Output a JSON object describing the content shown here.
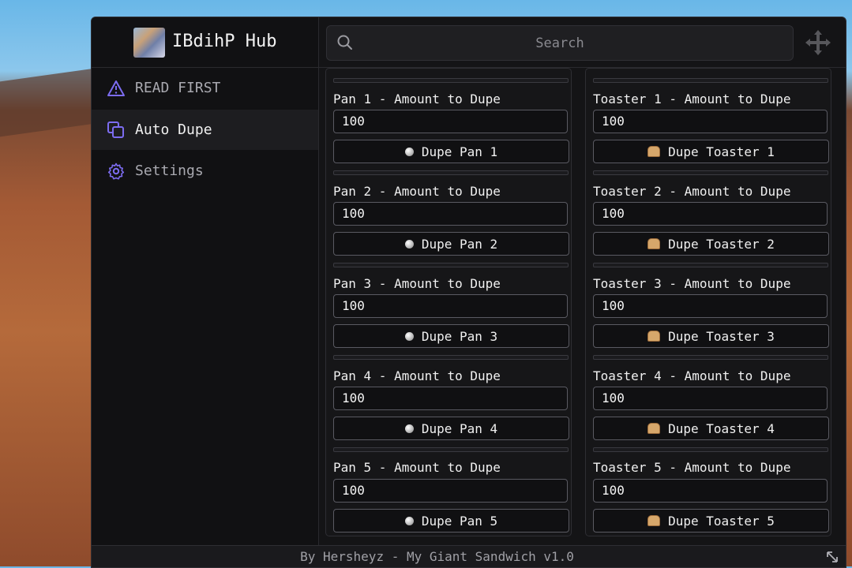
{
  "app": {
    "title": "IBdihP Hub"
  },
  "sidebar": {
    "items": [
      {
        "label": "READ FIRST",
        "icon": "warning-icon",
        "active": false
      },
      {
        "label": "Auto Dupe",
        "icon": "copy-icon",
        "active": true
      },
      {
        "label": "Settings",
        "icon": "gear-icon",
        "active": false
      }
    ]
  },
  "search": {
    "placeholder": "Search"
  },
  "pans": [
    {
      "label": "Pan 1 - Amount to Dupe",
      "value": "100",
      "button": "Dupe Pan 1"
    },
    {
      "label": "Pan 2 - Amount to Dupe",
      "value": "100",
      "button": "Dupe Pan 2"
    },
    {
      "label": "Pan 3 - Amount to Dupe",
      "value": "100",
      "button": "Dupe Pan 3"
    },
    {
      "label": "Pan 4 - Amount to Dupe",
      "value": "100",
      "button": "Dupe Pan 4"
    },
    {
      "label": "Pan 5 - Amount to Dupe",
      "value": "100",
      "button": "Dupe Pan 5"
    }
  ],
  "toasters": [
    {
      "label": "Toaster 1 - Amount to Dupe",
      "value": "100",
      "button": "Dupe Toaster 1"
    },
    {
      "label": "Toaster 2 - Amount to Dupe",
      "value": "100",
      "button": "Dupe Toaster 2"
    },
    {
      "label": "Toaster 3 - Amount to Dupe",
      "value": "100",
      "button": "Dupe Toaster 3"
    },
    {
      "label": "Toaster 4 - Amount to Dupe",
      "value": "100",
      "button": "Dupe Toaster 4"
    },
    {
      "label": "Toaster 5 - Amount to Dupe",
      "value": "100",
      "button": "Dupe Toaster 5"
    }
  ],
  "footer": {
    "text": "By Hersheyz - My Giant Sandwich v1.0"
  },
  "colors": {
    "accent": "#7c6cf0",
    "window_bg": "#141416",
    "text": "#f0f0f0"
  }
}
